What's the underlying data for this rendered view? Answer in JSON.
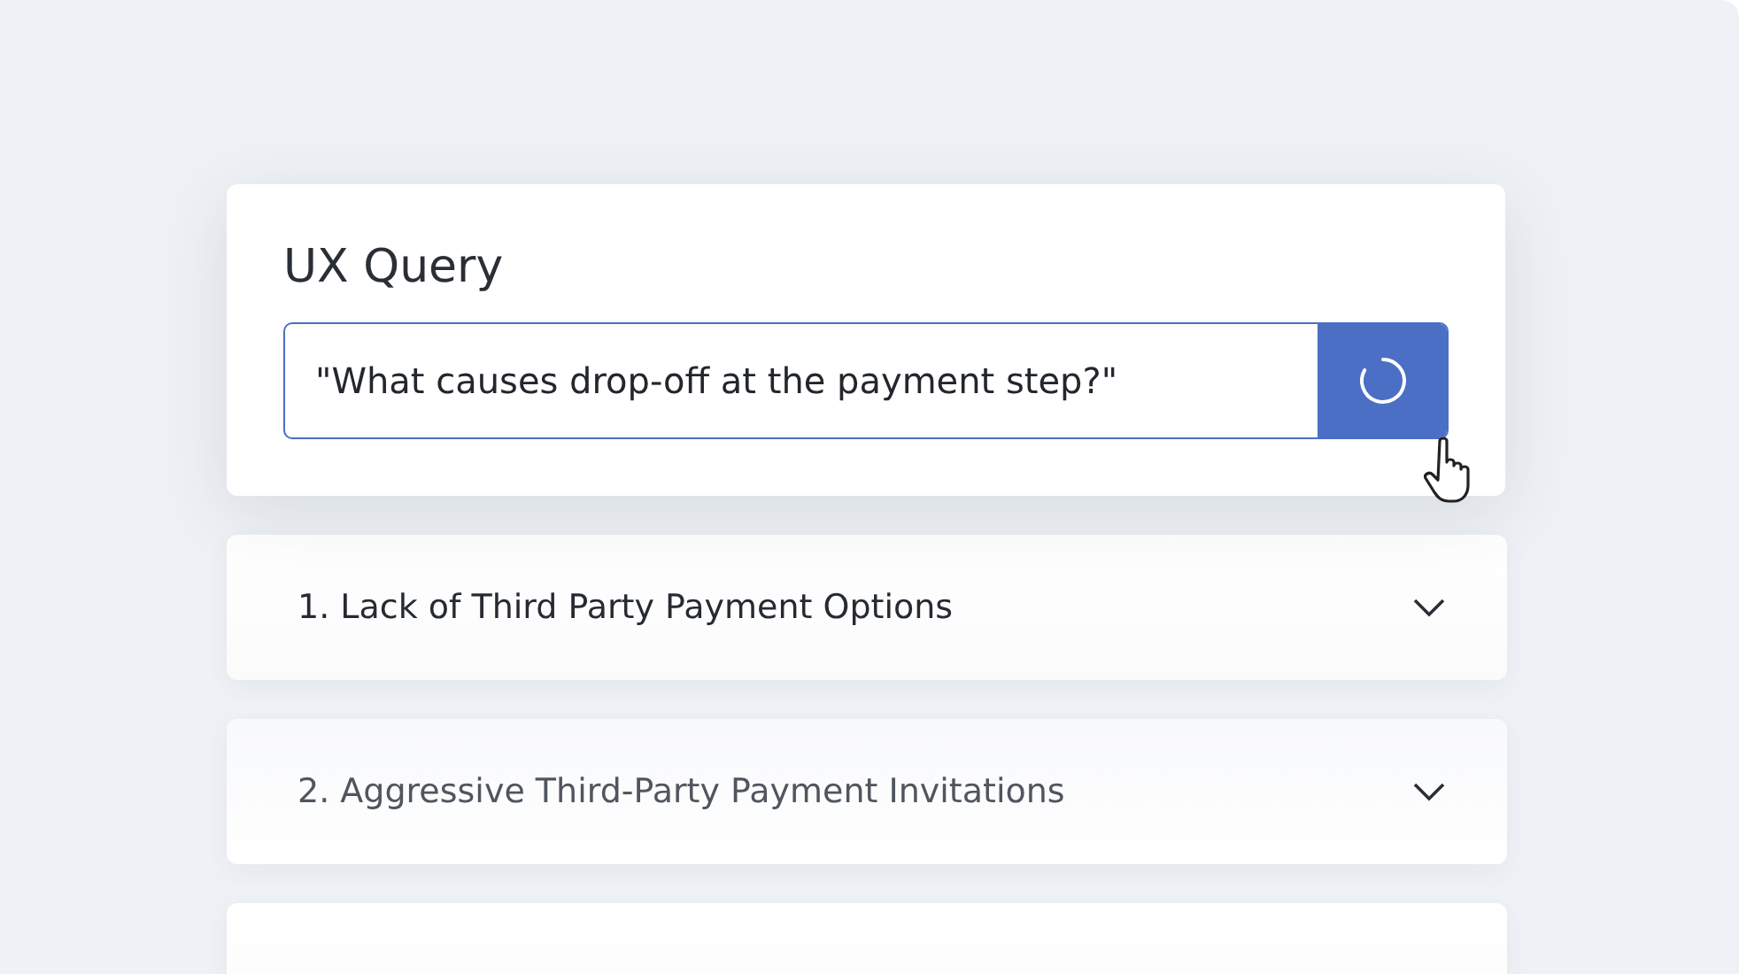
{
  "query_card": {
    "title": "UX Query",
    "query": "\"What causes drop-off at the payment step?\"",
    "loading": true
  },
  "results": [
    {
      "kind": "item",
      "label": "1. Lack of Third Party Payment Options",
      "dimmed": false
    },
    {
      "kind": "item",
      "label": "2. Aggressive Third-Party Payment Invitations",
      "dimmed": true
    },
    {
      "kind": "cut"
    }
  ]
}
